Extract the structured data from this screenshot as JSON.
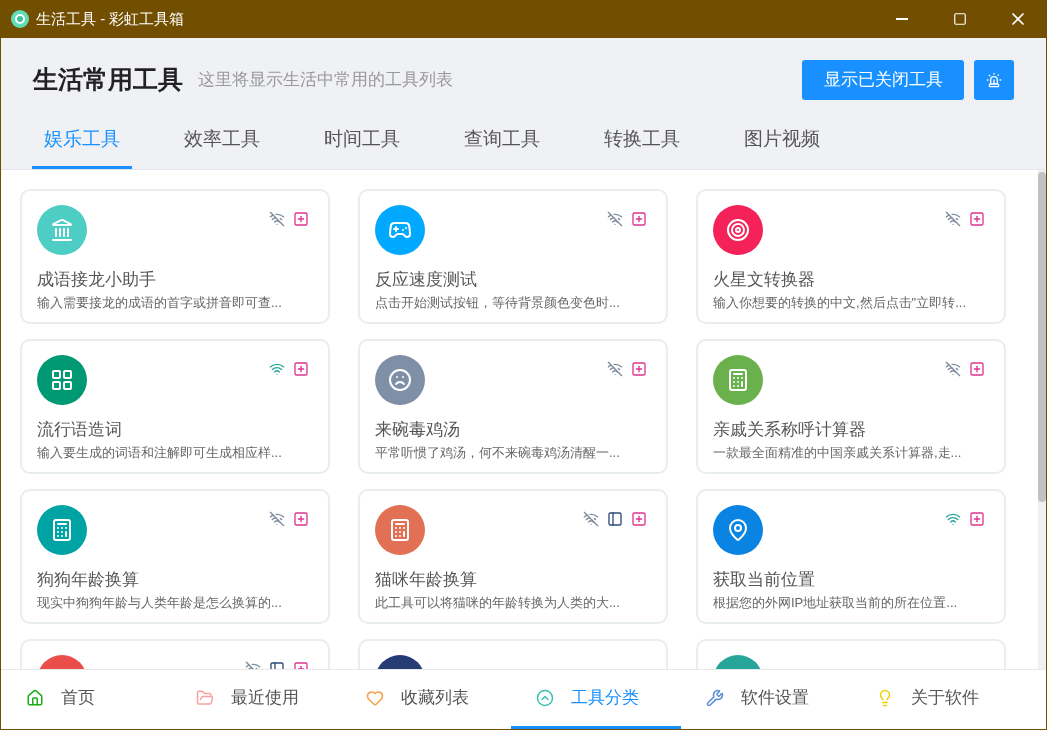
{
  "window": {
    "title": "生活工具 - 彩虹工具箱"
  },
  "header": {
    "title": "生活常用工具",
    "subtitle": "这里将显示生活中常用的工具列表",
    "show_closed_button": "显示已关闭工具"
  },
  "tabs": [
    {
      "label": "娱乐工具",
      "selected": true
    },
    {
      "label": "效率工具",
      "selected": false
    },
    {
      "label": "时间工具",
      "selected": false
    },
    {
      "label": "查询工具",
      "selected": false
    },
    {
      "label": "转换工具",
      "selected": false
    },
    {
      "label": "图片视频",
      "selected": false
    }
  ],
  "cards": [
    {
      "title": "成语接龙小助手",
      "description": "输入需要接龙的成语的首字或拼音即可查...",
      "color": "#4ecdc4",
      "online": false,
      "local": false
    },
    {
      "title": "反应速度测试",
      "description": "点击开始测试按钮，等待背景颜色变色时...",
      "color": "#00a8ff",
      "online": false,
      "local": false
    },
    {
      "title": "火星文转换器",
      "description": "输入你想要的转换的中文,然后点击\"立即转...",
      "color": "#f5225a",
      "online": false,
      "local": false
    },
    {
      "title": "流行语造词",
      "description": "输入要生成的词语和注解即可生成相应样...",
      "color": "#009973",
      "online": true,
      "local": false
    },
    {
      "title": "来碗毒鸡汤",
      "description": "平常听惯了鸡汤，何不来碗毒鸡汤清醒一...",
      "color": "#7f8fa6",
      "online": false,
      "local": false
    },
    {
      "title": "亲戚关系称呼计算器",
      "description": "一款最全面精准的中国亲戚关系计算器,走...",
      "color": "#6ab04c",
      "online": false,
      "local": false
    },
    {
      "title": "狗狗年龄换算",
      "description": "现实中狗狗年龄与人类年龄是怎么换算的...",
      "color": "#00a3a3",
      "online": false,
      "local": false
    },
    {
      "title": "猫咪年龄换算",
      "description": "此工具可以将猫咪的年龄转换为人类的大...",
      "color": "#e17055",
      "online": false,
      "local": true
    },
    {
      "title": "获取当前位置",
      "description": "根据您的外网IP地址获取当前的所在位置...",
      "color": "#0984e3",
      "online": true,
      "local": false
    }
  ],
  "partial_cards": [
    {
      "color": "#eb4d4b",
      "online": false,
      "local": true
    },
    {
      "color": "#273c75"
    },
    {
      "color": "#26a69a"
    }
  ],
  "bottom_nav": [
    {
      "label": "首页",
      "selected": false
    },
    {
      "label": "最近使用",
      "selected": false
    },
    {
      "label": "收藏列表",
      "selected": false
    },
    {
      "label": "工具分类",
      "selected": true
    },
    {
      "label": "软件设置",
      "selected": false
    },
    {
      "label": "关于软件",
      "selected": false
    }
  ]
}
